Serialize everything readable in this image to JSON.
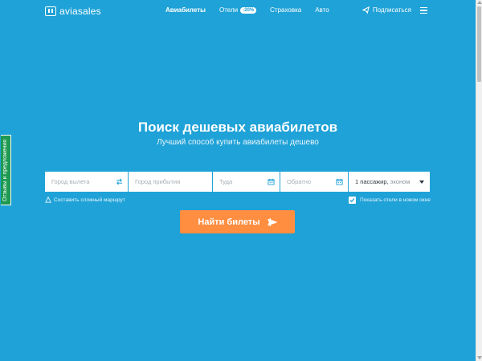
{
  "header": {
    "logo_text": "aviasales",
    "nav": [
      {
        "label": "Авиабилеты",
        "active": true
      },
      {
        "label": "Отели",
        "badge": "-20%"
      },
      {
        "label": "Страховка"
      },
      {
        "label": "Авто"
      }
    ],
    "subscribe_label": "Подписаться"
  },
  "feedback_tab": "Отзывы и предложения",
  "hero": {
    "title": "Поиск дешевых авиабилетов",
    "subtitle": "Лучший способ купить авиабилеты дешево"
  },
  "search_form": {
    "origin_placeholder": "Город вылета",
    "destination_placeholder": "Город прибытия",
    "depart_placeholder": "Туда",
    "return_placeholder": "Обратно",
    "passengers_value": "1 пассажир,",
    "cabin_class": "эконом",
    "complex_route_label": "Составить сложный маршрут",
    "show_hotels_label": "Показать отели в новом окне",
    "show_hotels_checked": true,
    "submit_label": "Найти билеты"
  },
  "colors": {
    "background": "#1fa2d7",
    "button": "#ff8e41",
    "feedback_tab": "#1e9a52"
  }
}
